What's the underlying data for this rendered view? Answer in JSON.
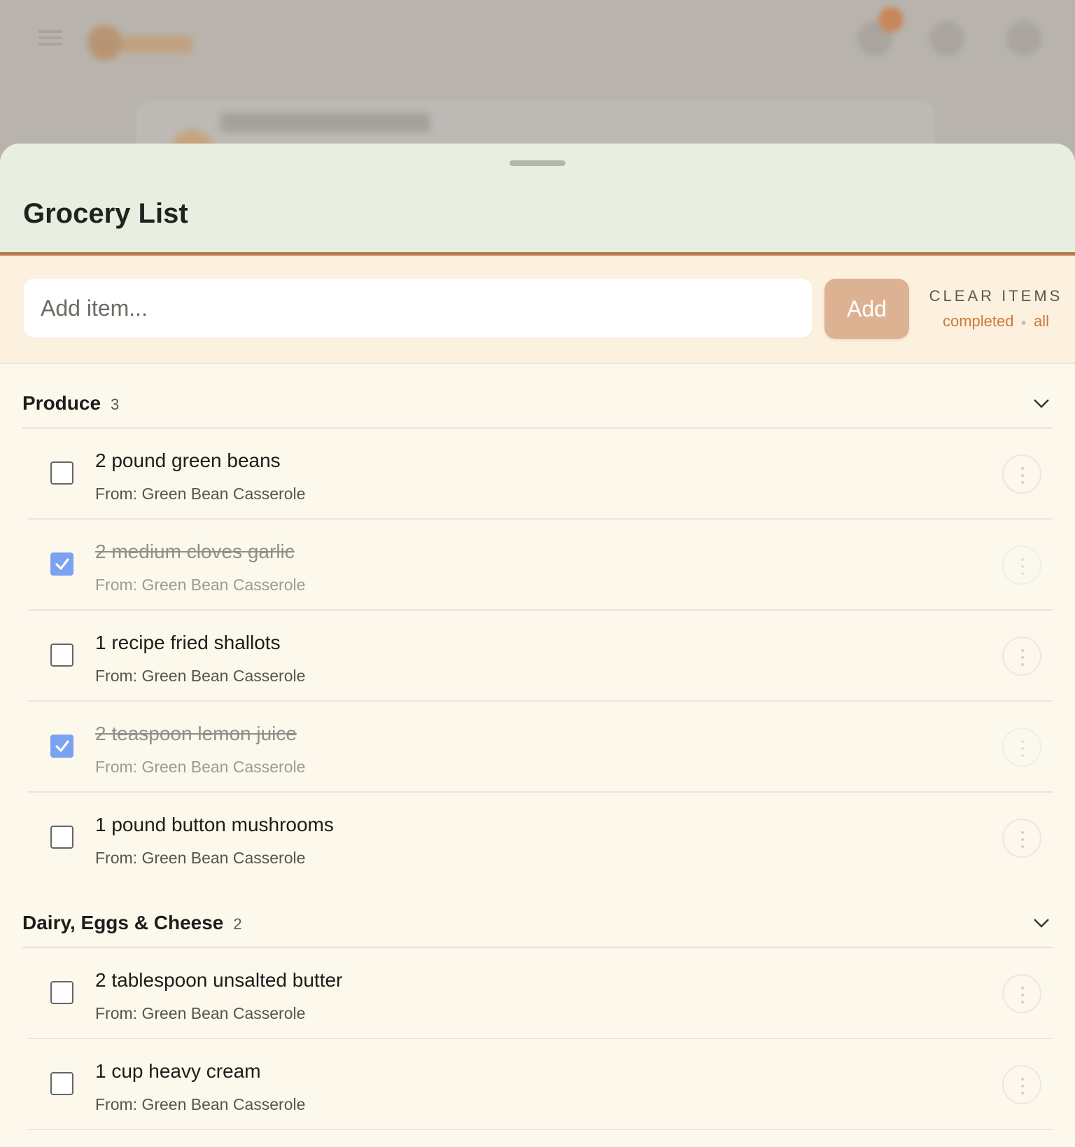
{
  "sheet": {
    "title": "Grocery List"
  },
  "add_bar": {
    "placeholder": "Add item...",
    "add_label": "Add",
    "clear_title": "CLEAR ITEMS",
    "clear_completed": "completed",
    "clear_all": "all"
  },
  "sections": [
    {
      "name": "Produce",
      "count": "3",
      "items": [
        {
          "name": "2 pound green beans",
          "source": "From: Green Bean Casserole",
          "checked": false
        },
        {
          "name": "2 medium cloves garlic",
          "source": "From: Green Bean Casserole",
          "checked": true
        },
        {
          "name": "1 recipe fried shallots",
          "source": "From: Green Bean Casserole",
          "checked": false
        },
        {
          "name": "2 teaspoon lemon juice",
          "source": "From: Green Bean Casserole",
          "checked": true
        },
        {
          "name": "1 pound button mushrooms",
          "source": "From: Green Bean Casserole",
          "checked": false
        }
      ]
    },
    {
      "name": "Dairy, Eggs & Cheese",
      "count": "2",
      "items": [
        {
          "name": "2 tablespoon unsalted butter",
          "source": "From: Green Bean Casserole",
          "checked": false
        },
        {
          "name": "1 cup heavy cream",
          "source": "From: Green Bean Casserole",
          "checked": false
        }
      ]
    }
  ],
  "colors": {
    "header_bg": "#e8eee0",
    "accent": "#b97a4e",
    "add_button": "#ddb293",
    "link": "#cc7a3b",
    "checkbox_checked": "#7aa2f0"
  }
}
